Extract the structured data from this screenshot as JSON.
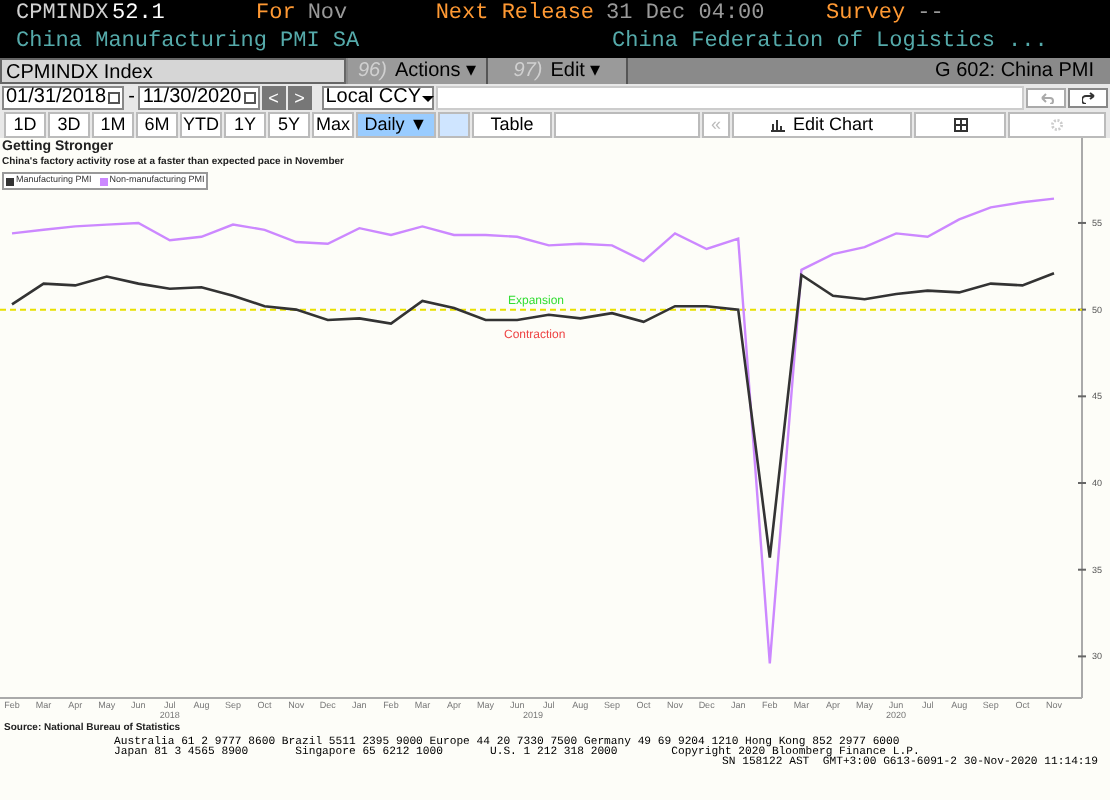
{
  "header": {
    "ticker": "CPMINDX",
    "value": "52.1",
    "for_label": "For",
    "for_value": "Nov",
    "release_label": "Next Release",
    "release_value": "31 Dec 04:00",
    "survey_label": "Survey",
    "survey_value": "--",
    "name": "China Manufacturing PMI SA",
    "source": "China Federation of Logistics ..."
  },
  "toolbar": {
    "security": "CPMINDX Index",
    "menus": [
      {
        "number": "96)",
        "label": "Actions ▾"
      },
      {
        "number": "97)",
        "label": "Edit ▾"
      }
    ],
    "page_title": "G 602: China PMI"
  },
  "range": {
    "start": "01/31/2018",
    "separator": "-",
    "end": "11/30/2020",
    "currency": "Local CCY",
    "previous": "<",
    "next": ">"
  },
  "periods": [
    {
      "label": "1D",
      "selected": false
    },
    {
      "label": "3D",
      "selected": false
    },
    {
      "label": "1M",
      "selected": false
    },
    {
      "label": "6M",
      "selected": false
    },
    {
      "label": "YTD",
      "selected": false
    },
    {
      "label": "1Y",
      "selected": false
    },
    {
      "label": "5Y",
      "selected": false
    },
    {
      "label": "Max",
      "selected": false
    },
    {
      "label": "Daily ▼",
      "selected": true
    }
  ],
  "chart_buttons": {
    "table": "Table",
    "back": "«",
    "edit_chart": "Edit Chart"
  },
  "chart": {
    "title": "Getting Stronger",
    "subtitle": "China's factory activity rose at a faster than expected pace in November",
    "expansion_label": "Expansion",
    "contraction_label": "Contraction",
    "years": [
      "2018",
      "2019",
      "2020"
    ],
    "chart_data": {
      "type": "line",
      "categories": [
        "Feb",
        "Mar",
        "Apr",
        "May",
        "Jun",
        "Jul",
        "Aug",
        "Sep",
        "Oct",
        "Nov",
        "Dec",
        "Jan",
        "Feb",
        "Mar",
        "Apr",
        "May",
        "Jun",
        "Jul",
        "Aug",
        "Sep",
        "Oct",
        "Nov",
        "Dec",
        "Jan",
        "Feb",
        "Mar",
        "Apr",
        "May",
        "Jun",
        "Jul",
        "Aug",
        "Sep",
        "Oct",
        "Nov"
      ],
      "ylim": [
        27.6,
        59.9
      ],
      "legend": "upper left",
      "yticks": [
        30,
        35,
        40,
        45,
        50,
        55
      ],
      "series": [
        {
          "name": "Manufacturing PMI",
          "color": "#333333",
          "values": [
            50.3,
            51.5,
            51.4,
            51.9,
            51.5,
            51.2,
            51.3,
            50.8,
            50.2,
            50.0,
            49.4,
            49.5,
            49.2,
            50.5,
            50.1,
            49.4,
            49.4,
            49.7,
            49.5,
            49.8,
            49.3,
            50.2,
            50.2,
            50.0,
            35.7,
            52.0,
            50.8,
            50.6,
            50.9,
            51.1,
            51.0,
            51.5,
            51.4,
            52.1
          ]
        },
        {
          "name": "Non-manufacturing PMI",
          "color": "#cc88ff",
          "values": [
            54.4,
            54.6,
            54.8,
            54.9,
            55.0,
            54.0,
            54.2,
            54.9,
            54.6,
            53.9,
            53.8,
            54.7,
            54.3,
            54.8,
            54.3,
            54.3,
            54.2,
            53.7,
            53.8,
            53.7,
            52.8,
            54.4,
            53.5,
            54.1,
            29.6,
            52.3,
            53.2,
            53.6,
            54.4,
            54.2,
            55.2,
            55.9,
            56.2,
            56.4
          ]
        }
      ],
      "ref_lines": [
        {
          "axis": "y",
          "value": 50
        }
      ]
    },
    "source_note": "Source: National Bureau of Statistics"
  },
  "footer": [
    "Australia 61 2 9777 8600 Brazil 5511 2395 9000 Europe 44 20 7330 7500 Germany 49 69 9204 1210 Hong Kong 852 2977 6000",
    "Japan 81 3 4565 8900       Singapore 65 6212 1000       U.S. 1 212 318 2000        Copyright 2020 Bloomberg Finance L.P.",
    "SN 158122 AST  GMT+3:00 G613-6091-2 30-Nov-2020 11:14:19"
  ]
}
